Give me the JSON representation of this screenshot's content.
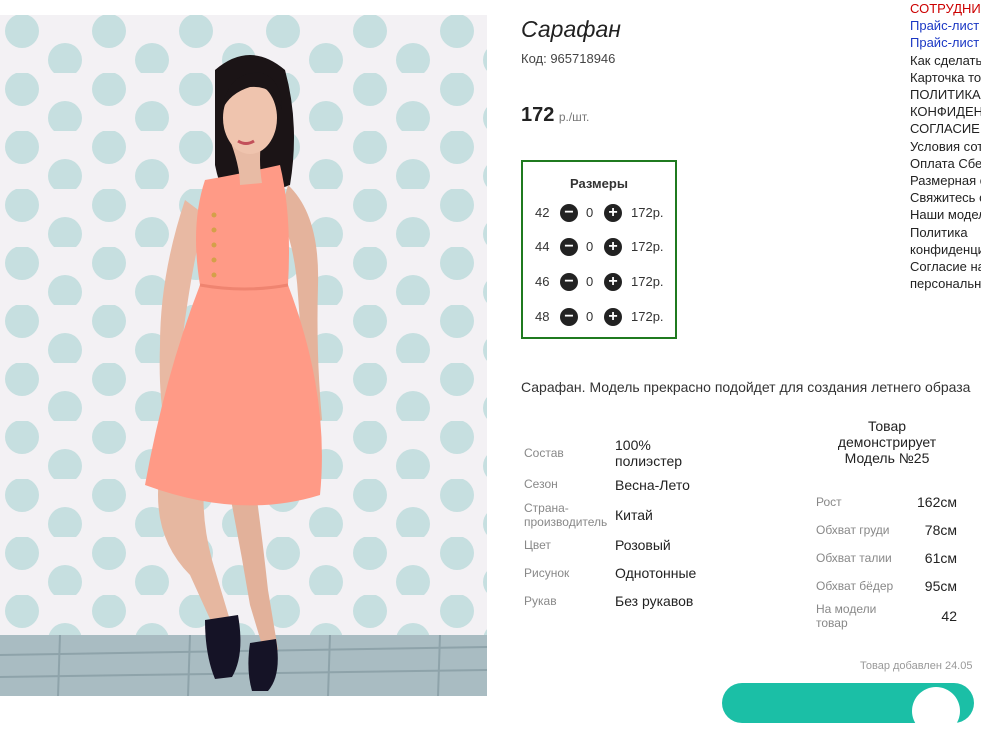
{
  "product": {
    "title": "Сарафан",
    "code_label": "Код: 965718946",
    "price": "172",
    "price_unit": "р./шт."
  },
  "sizes": {
    "title": "Размеры",
    "rows": [
      {
        "size": "42",
        "qty": "0",
        "price": "172р."
      },
      {
        "size": "44",
        "qty": "0",
        "price": "172р."
      },
      {
        "size": "46",
        "qty": "0",
        "price": "172р."
      },
      {
        "size": "48",
        "qty": "0",
        "price": "172р."
      }
    ]
  },
  "description": "Сарафан. Модель прекрасно подойдет для создания летнего образа",
  "attributes": [
    {
      "label": "Состав",
      "value": "100% полиэстер"
    },
    {
      "label": "Сезон",
      "value": "Весна-Лето"
    },
    {
      "label": "Страна-производитель",
      "value": "Китай"
    },
    {
      "label": "Цвет",
      "value": "Розовый"
    },
    {
      "label": "Рисунок",
      "value": "Однотонные"
    },
    {
      "label": "Рукав",
      "value": "Без рукавов"
    }
  ],
  "model": {
    "heading": "Товар демонстрирует Модель №25",
    "measurements": [
      {
        "label": "Рост",
        "value": "162см"
      },
      {
        "label": "Обхват груди",
        "value": "78см"
      },
      {
        "label": "Обхват талии",
        "value": "61см"
      },
      {
        "label": "Обхват бёдер",
        "value": "95см"
      },
      {
        "label": "На модели товар",
        "value": "42"
      }
    ]
  },
  "added_text": "Товар добавлен 24.05",
  "side_links": [
    {
      "text": "СОТРУДНИЧЕСТВО",
      "color": "#c00000"
    },
    {
      "text": "Прайс-лист",
      "color": "#1a37c4"
    },
    {
      "text": "Прайс-лист",
      "color": "#1a37c4"
    },
    {
      "text": "Как сделать заказ",
      "color": "#222222"
    },
    {
      "text": "Карточка товара",
      "color": "#222222"
    },
    {
      "text": "ПОЛИТИКА",
      "color": "#222222"
    },
    {
      "text": "КОНФИДЕНЦИАЛЬНОСТИ",
      "color": "#222222"
    },
    {
      "text": "СОГЛАСИЕ",
      "color": "#222222"
    },
    {
      "text": "Условия сотрудничества",
      "color": "#222222"
    },
    {
      "text": "Оплата Сбербанк",
      "color": "#222222"
    },
    {
      "text": "Размерная сетка",
      "color": "#222222"
    },
    {
      "text": "Свяжитесь с нами",
      "color": "#222222"
    },
    {
      "text": "Наши модели",
      "color": "#222222"
    },
    {
      "text": "Политика",
      "color": "#222222"
    },
    {
      "text": "конфиденциальности",
      "color": "#222222"
    },
    {
      "text": "Согласие на обработку",
      "color": "#222222"
    },
    {
      "text": "персональных данных",
      "color": "#222222"
    }
  ],
  "colors": {
    "size_box_border": "#1f7a1f",
    "cart_button": "#1bbfa6"
  }
}
